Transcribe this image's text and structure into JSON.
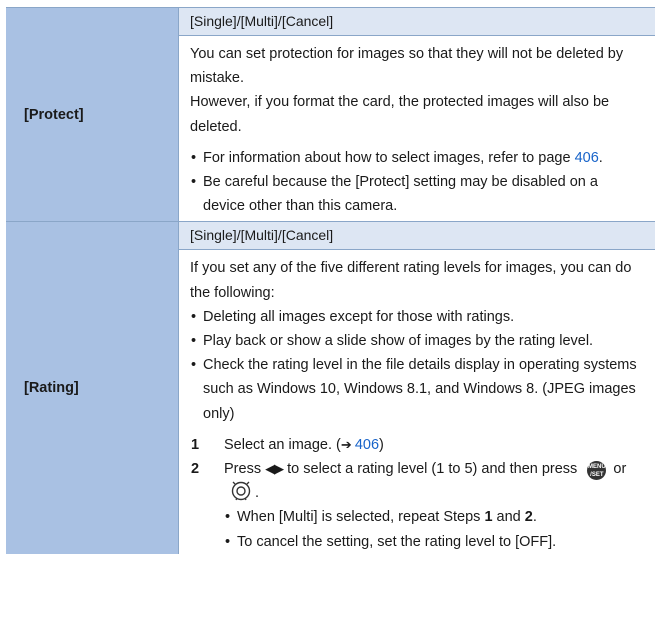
{
  "rows": [
    {
      "label": "[Protect]",
      "options": "[Single]/[Multi]/[Cancel]",
      "paragraphs": [
        "You can set protection for images so that they will not be deleted by mistake.",
        "However, if you format the card, the protected images will also be deleted."
      ],
      "bullet1_text": "For information about how to select images, refer to page",
      "bullet1_link": "406",
      "bullet1_end": ".",
      "bullet2_text": "Be careful because the [Protect] setting may be disabled on a device other than this camera."
    },
    {
      "label": "[Rating]",
      "options": "[Single]/[Multi]/[Cancel]",
      "intro": "If you set any of the five different rating levels for images, you can do the following:",
      "bullets": [
        "Deleting all images except for those with ratings.",
        "Play back or show a slide show of images by the rating level.",
        "Check the rating level in the file details display in operating systems such as Windows 10, Windows 8.1, and Windows 8. (JPEG images only)"
      ],
      "step1_num": "1",
      "step1_text": "Select an image. (",
      "step1_arrow": "➔",
      "step1_link": "406",
      "step1_end": ")",
      "step2_num": "2",
      "step2_text_a": "Press",
      "step2_arrows": "◀▶",
      "step2_text_b": "to select a rating level (1 to 5) and then press",
      "step2_or": "or",
      "step2_end": ".",
      "menu_icon_line1": "MENU",
      "menu_icon_line2": "/SET",
      "sub1_a": "When [Multi] is selected, repeat Steps",
      "sub1_b": "1",
      "sub1_c": "and",
      "sub1_d": "2",
      "sub1_e": ".",
      "sub2": "To cancel the setting, set the rating level to [OFF]."
    }
  ],
  "icons": {
    "menu": "menu-set-button-icon",
    "dial": "control-dial-icon"
  },
  "colors": {
    "label_bg": "#a9c1e3",
    "options_bg": "#dde6f3",
    "border": "#8aa6c8",
    "link": "#1763c9"
  }
}
